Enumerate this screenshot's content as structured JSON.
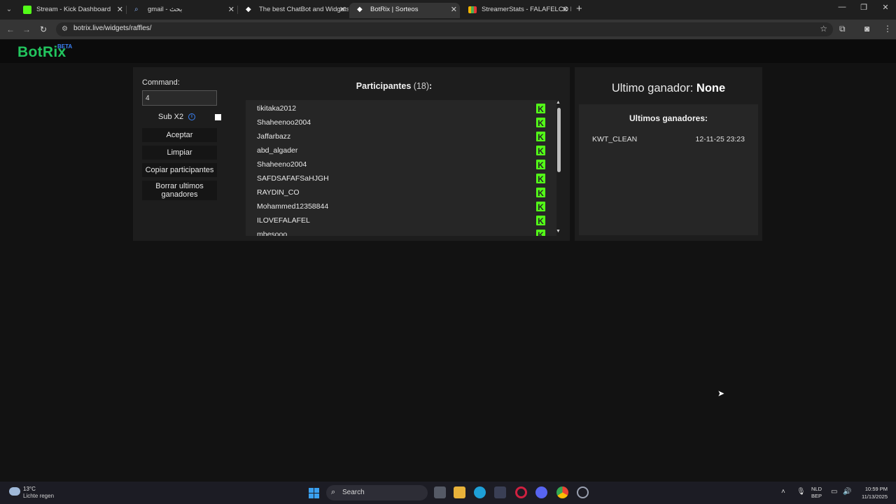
{
  "browser": {
    "tabs": [
      {
        "title": "Stream - Kick Dashboard",
        "icon": "kick-icon",
        "active": false
      },
      {
        "title": "gmail - بحث",
        "icon": "search-icon",
        "active": false
      },
      {
        "title": "The best ChatBot and Widgets",
        "icon": "botrix-icon",
        "active": false
      },
      {
        "title": "BotRix | Sorteos",
        "icon": "botrix-icon",
        "active": true
      },
      {
        "title": "StreamerStats - FALAFELCO Pro",
        "icon": "stats-icon",
        "active": false
      }
    ],
    "new_tab": "+",
    "url": "botrix.live/widgets/raffles/"
  },
  "site": {
    "logo": "BotRix",
    "logo_badge": "BETA"
  },
  "raffle": {
    "command_label": "Command:",
    "command_value": "4",
    "sub_label": "Sub X2",
    "sub_checked": false,
    "buttons": {
      "accept": "Aceptar",
      "clear": "Limpiar",
      "copy": "Copiar participantes",
      "delete_winners": "Borrar ultimos ganadores"
    },
    "participants_title": "Participantes",
    "participants_count": "(18)",
    "participants_colon": ":",
    "participants": [
      "tikitaka2012",
      "Shaheenoo2004",
      "Jaffarbazz",
      "abd_algader",
      "Shaheeno2004",
      "SAFDSAFAFSaHJGH",
      "RAYDIN_CO",
      "Mohammed12358844",
      "ILOVEFALAFEL",
      "mbesooo"
    ]
  },
  "winners": {
    "last_winner_label": "Ultimo ganador:",
    "last_winner_value": "None",
    "history_title": "Ultimos ganadores:",
    "history": [
      {
        "name": "KWT_CLEAN",
        "date": "12-11-25 23:23"
      }
    ]
  },
  "taskbar": {
    "weather_temp": "13°C",
    "weather_desc": "Lichte regen",
    "search_placeholder": "Search",
    "lang_top": "NLD",
    "lang_bottom": "BEP",
    "time": "10:59 PM",
    "date": "11/13/2025"
  },
  "colors": {
    "brand_green": "#22c55e",
    "kick_green": "#53fc18",
    "beta_blue": "#3b82f6"
  }
}
